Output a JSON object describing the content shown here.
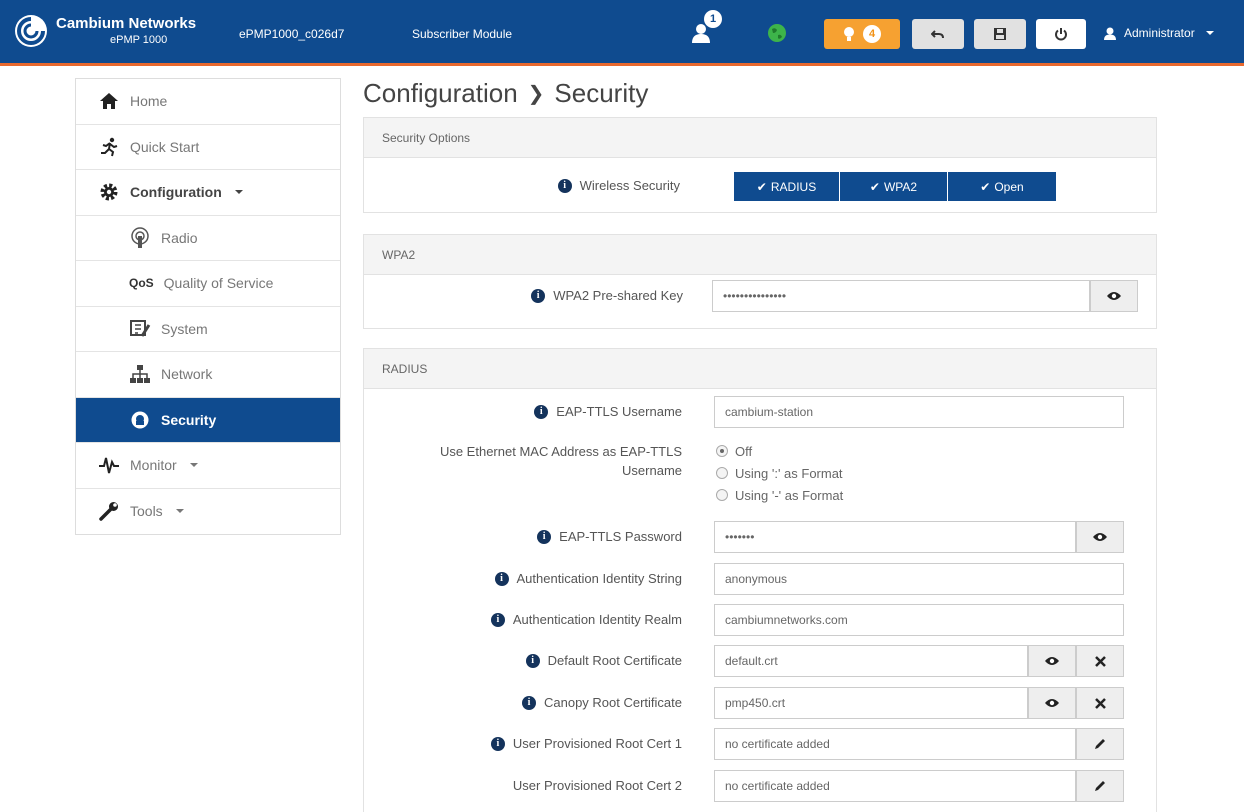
{
  "header": {
    "brand_name": "Cambium Networks",
    "brand_model": "ePMP 1000",
    "device_name": "ePMP1000_c026d7",
    "device_mode": "Subscriber Module",
    "user_badge_count": "1",
    "alert_count": "4",
    "admin_label": "Administrator",
    "colors": {
      "bar": "#0f4b8f",
      "accent": "#e8692e",
      "alert": "#f6a131",
      "globe": "#3db44a"
    }
  },
  "sidebar": {
    "items": [
      {
        "label": "Home",
        "icon": "home-icon"
      },
      {
        "label": "Quick Start",
        "icon": "run-icon"
      },
      {
        "label": "Configuration",
        "icon": "gear-icon",
        "dropdown": true
      },
      {
        "label": "Radio",
        "icon": "radio-icon"
      },
      {
        "label": "Quality of Service",
        "icon": "qos-icon",
        "badge": "QoS"
      },
      {
        "label": "System",
        "icon": "system-icon"
      },
      {
        "label": "Network",
        "icon": "network-icon"
      },
      {
        "label": "Security",
        "icon": "security-icon",
        "active": true
      },
      {
        "label": "Monitor",
        "icon": "pulse-icon",
        "dropdown": true
      },
      {
        "label": "Tools",
        "icon": "wrench-icon",
        "dropdown": true
      }
    ]
  },
  "page": {
    "title_section": "Configuration",
    "title_page": "Security"
  },
  "security_options": {
    "heading": "Security Options",
    "wireless_security_label": "Wireless Security",
    "options": [
      "RADIUS",
      "WPA2",
      "Open"
    ]
  },
  "wpa2": {
    "heading": "WPA2",
    "psk_label": "WPA2 Pre-shared Key",
    "psk_value": "•••••••••••••••"
  },
  "radius": {
    "heading": "RADIUS",
    "username_label": "EAP-TTLS Username",
    "username_value": "cambium-station",
    "mac_label_line1": "Use Ethernet MAC Address as EAP-TTLS",
    "mac_label_line2": "Username",
    "mac_options": [
      "Off",
      "Using ':' as Format",
      "Using '-' as Format"
    ],
    "mac_selected": "Off",
    "password_label": "EAP-TTLS Password",
    "password_value": "•••••••",
    "identity_string_label": "Authentication Identity String",
    "identity_string_value": "anonymous",
    "identity_realm_label": "Authentication Identity Realm",
    "identity_realm_value": "cambiumnetworks.com",
    "default_cert_label": "Default Root Certificate",
    "default_cert_value": "default.crt",
    "canopy_cert_label": "Canopy Root Certificate",
    "canopy_cert_value": "pmp450.crt",
    "user_cert1_label": "User Provisioned Root Cert 1",
    "user_cert1_value": "no certificate added",
    "user_cert2_label": "User Provisioned Root Cert 2",
    "user_cert2_value": "no certificate added"
  }
}
